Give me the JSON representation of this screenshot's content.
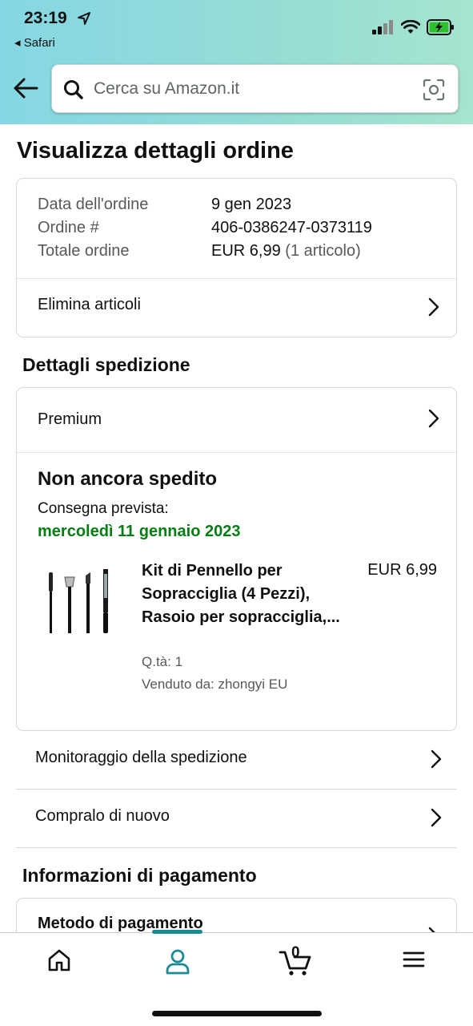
{
  "status_bar": {
    "time": "23:19",
    "back_app": "◂ Safari"
  },
  "search": {
    "placeholder": "Cerca su Amazon.it"
  },
  "page": {
    "title": "Visualizza dettagli ordine"
  },
  "order_summary": {
    "date_label": "Data dell'ordine",
    "date_value": "9 gen 2023",
    "number_label": "Ordine #",
    "number_value": "406-0386247-0373119",
    "total_label": "Totale ordine",
    "total_value": "EUR 6,99",
    "total_items": "(1 articolo)",
    "delete_items": "Elimina articoli"
  },
  "shipping": {
    "section_title": "Dettagli spedizione",
    "premium_label": "Premium",
    "status": "Non ancora spedito",
    "delivery_label": "Consegna prevista:",
    "delivery_date": "mercoledì 11 gennaio 2023",
    "item": {
      "title": "Kit di Pennello per Sopracciglia (4 Pezzi), Rasoio per sopracciglia,...",
      "price": "EUR 6,99",
      "quantity": "Q.tà: 1",
      "seller": "Venduto da: zhongyi EU"
    },
    "track_label": "Monitoraggio della spedizione",
    "buy_again_label": "Compralo di nuovo"
  },
  "payment": {
    "section_title": "Informazioni di pagamento",
    "method_label": "Metodo di pagamento"
  },
  "tabbar": {
    "cart_count": "0"
  },
  "colors": {
    "header_teal": "#94dcd5",
    "delivery_green": "#067d12",
    "tab_active": "#1a8b95"
  }
}
